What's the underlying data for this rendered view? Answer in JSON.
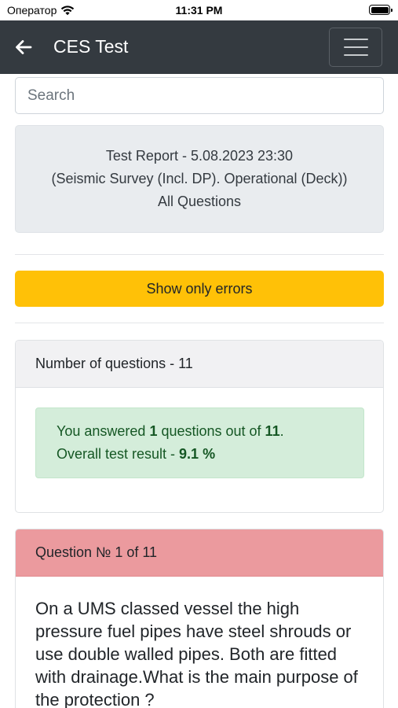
{
  "status_bar": {
    "carrier": "Оператор",
    "time": "11:31 PM"
  },
  "navbar": {
    "title": "CES Test"
  },
  "search": {
    "placeholder": "Search"
  },
  "report": {
    "line1": "Test Report - 5.08.2023 23:30",
    "line2": "(Seismic Survey (Incl. DP). Operational (Deck))",
    "line3": "All Questions"
  },
  "errors_button": {
    "label": "Show only errors"
  },
  "summary": {
    "header": "Number of questions - 11",
    "answered_prefix": "You answered ",
    "answered_count": "1",
    "answered_middle": " questions out of ",
    "total_count": "11",
    "answered_suffix": ".",
    "result_prefix": "Overall test result - ",
    "result_value": "9.1 %"
  },
  "question": {
    "header": "Question № 1 of 11",
    "text": "On a UMS classed vessel the high pressure fuel pipes have steel shrouds or use double walled pipes. Both are fitted with drainage.What is the main purpose of the protection ?"
  },
  "colors": {
    "navbar": "#343a40",
    "warning": "#ffc107",
    "success_bg": "#d4edda",
    "success_text": "#155724",
    "danger_header": "#eb9a9e"
  }
}
